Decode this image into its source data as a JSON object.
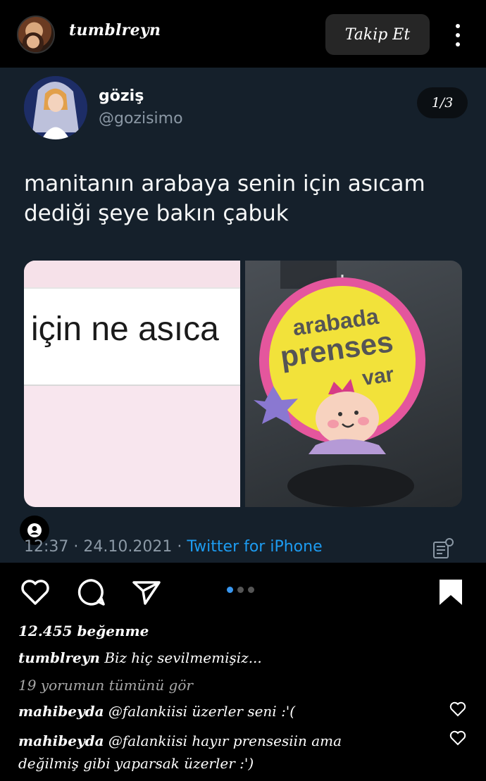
{
  "post_header": {
    "username": "tumblreyn",
    "follow_label": "Takip Et"
  },
  "tweet": {
    "name": "göziş",
    "handle": "@gozisimo",
    "page_indicator": "1/3",
    "text": "manitanın arabaya senin için asıcam dediği şeye bakın çabuk",
    "media_left_text": "için ne asıca",
    "media_right_text": {
      "line1": "arabada",
      "line2": "prenses",
      "line3": "var"
    },
    "time": "12:37",
    "date": "24.10.2021",
    "source": "Twitter for iPhone"
  },
  "post_footer": {
    "likes": "12.455 beğenme",
    "caption_user": "tumblreyn",
    "caption_text": "Biz hiç sevilmemişiz...",
    "view_comments": "19 yorumun tümünü gör",
    "comments": [
      {
        "user": "mahibeyda",
        "text": "@falankiisi üzerler seni :'("
      },
      {
        "user": "mahibeyda",
        "text": "@falankiisi hayır prensesiin ama",
        "text2": "değilmiş gibi yaparsak üzerler :')"
      }
    ],
    "carousel": {
      "count": 3,
      "active": 1
    }
  },
  "colors": {
    "tweet_bg": "#15202b",
    "accent_link": "#1d9bf0",
    "carousel_active": "#3897f0",
    "sign_pink": "#e0509a",
    "sign_yellow": "#f3e33b"
  }
}
